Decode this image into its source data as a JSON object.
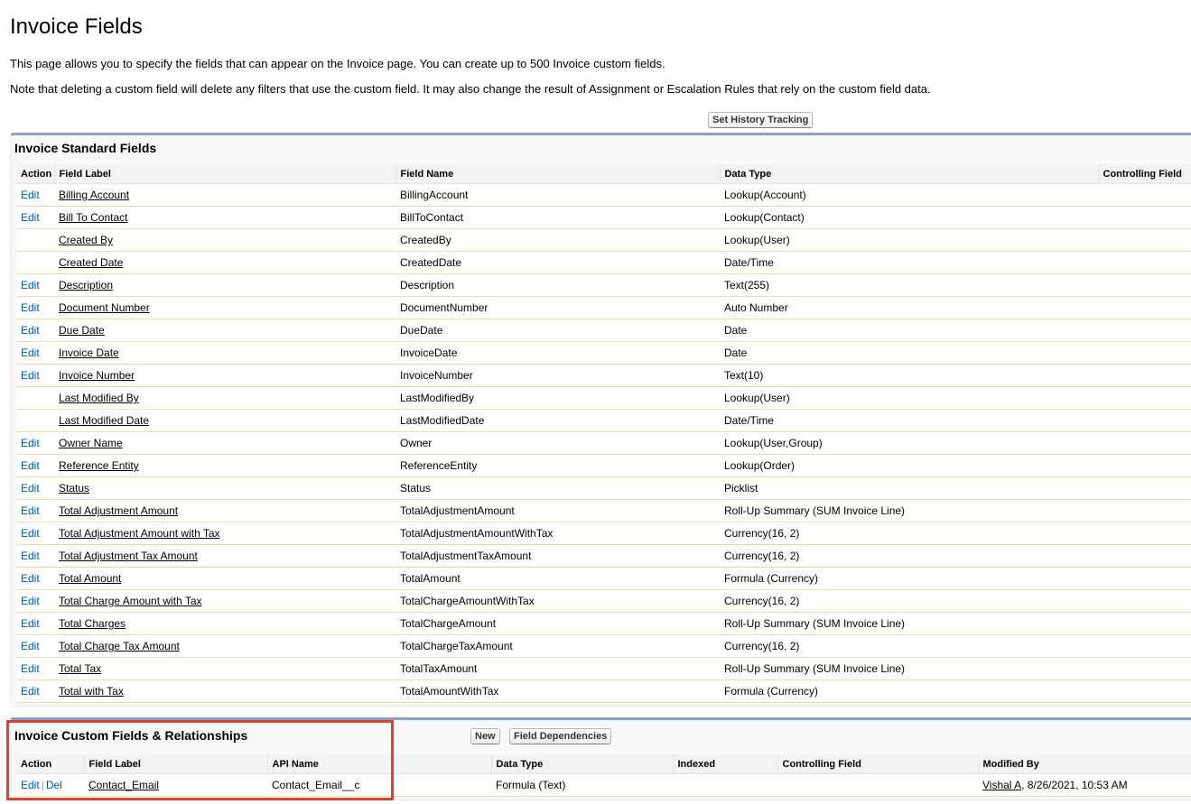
{
  "page": {
    "title": "Invoice Fields",
    "description": "This page allows you to specify the fields that can appear on the Invoice page. You can create up to 500 Invoice custom fields.",
    "note": "Note that deleting a custom field will delete any filters that use the custom field. It may also change the result of Assignment or Escalation Rules that rely on the custom field data."
  },
  "buttons": {
    "history_tracking": "Set History Tracking",
    "new": "New",
    "field_dependencies": "Field Dependencies"
  },
  "standard": {
    "title": "Invoice Standard Fields",
    "columns": [
      "Action",
      "Field Label",
      "Field Name",
      "Data Type",
      "Controlling Field"
    ],
    "rows": [
      {
        "action": "Edit",
        "label": "Billing Account",
        "name": "BillingAccount",
        "type": "Lookup(Account)"
      },
      {
        "action": "Edit",
        "label": "Bill To Contact",
        "name": "BillToContact",
        "type": "Lookup(Contact)"
      },
      {
        "action": "",
        "label": "Created By",
        "name": "CreatedBy",
        "type": "Lookup(User)"
      },
      {
        "action": "",
        "label": "Created Date",
        "name": "CreatedDate",
        "type": "Date/Time"
      },
      {
        "action": "Edit",
        "label": "Description",
        "name": "Description",
        "type": "Text(255)"
      },
      {
        "action": "Edit",
        "label": "Document Number",
        "name": "DocumentNumber",
        "type": "Auto Number"
      },
      {
        "action": "Edit",
        "label": "Due Date",
        "name": "DueDate",
        "type": "Date"
      },
      {
        "action": "Edit",
        "label": "Invoice Date",
        "name": "InvoiceDate",
        "type": "Date"
      },
      {
        "action": "Edit",
        "label": "Invoice Number",
        "name": "InvoiceNumber",
        "type": "Text(10)"
      },
      {
        "action": "",
        "label": "Last Modified By",
        "name": "LastModifiedBy",
        "type": "Lookup(User)"
      },
      {
        "action": "",
        "label": "Last Modified Date",
        "name": "LastModifiedDate",
        "type": "Date/Time"
      },
      {
        "action": "Edit",
        "label": "Owner Name",
        "name": "Owner",
        "type": "Lookup(User,Group)"
      },
      {
        "action": "Edit",
        "label": "Reference Entity",
        "name": "ReferenceEntity",
        "type": "Lookup(Order)"
      },
      {
        "action": "Edit",
        "label": "Status",
        "name": "Status",
        "type": "Picklist"
      },
      {
        "action": "Edit",
        "label": "Total Adjustment Amount",
        "name": "TotalAdjustmentAmount",
        "type": "Roll-Up Summary (SUM Invoice Line)"
      },
      {
        "action": "Edit",
        "label": "Total Adjustment Amount with Tax",
        "name": "TotalAdjustmentAmountWithTax",
        "type": "Currency(16, 2)"
      },
      {
        "action": "Edit",
        "label": "Total Adjustment Tax Amount",
        "name": "TotalAdjustmentTaxAmount",
        "type": "Currency(16, 2)"
      },
      {
        "action": "Edit",
        "label": "Total Amount",
        "name": "TotalAmount",
        "type": "Formula (Currency)"
      },
      {
        "action": "Edit",
        "label": "Total Charge Amount with Tax",
        "name": "TotalChargeAmountWithTax",
        "type": "Currency(16, 2)"
      },
      {
        "action": "Edit",
        "label": "Total Charges",
        "name": "TotalChargeAmount",
        "type": "Roll-Up Summary (SUM Invoice Line)"
      },
      {
        "action": "Edit",
        "label": "Total Charge Tax Amount",
        "name": "TotalChargeTaxAmount",
        "type": "Currency(16, 2)"
      },
      {
        "action": "Edit",
        "label": "Total Tax",
        "name": "TotalTaxAmount",
        "type": "Roll-Up Summary (SUM Invoice Line)"
      },
      {
        "action": "Edit",
        "label": "Total with Tax",
        "name": "TotalAmountWithTax",
        "type": "Formula (Currency)"
      }
    ]
  },
  "custom": {
    "title": "Invoice Custom Fields & Relationships",
    "columns": [
      "Action",
      "Field Label",
      "API Name",
      "Data Type",
      "Indexed",
      "Controlling Field",
      "Modified By"
    ],
    "rows": [
      {
        "edit": "Edit",
        "del": "Del",
        "separator": "|",
        "label": "Contact_Email",
        "api": "Contact_Email__c",
        "type": "Formula (Text)",
        "modified_user": "Vishal A",
        "modified_date": ", 8/26/2021, 10:53 AM"
      }
    ]
  },
  "colors": {
    "link_blue": "#015ba7",
    "section_border": "#8a9ebe",
    "highlight_red": "#e0402f"
  }
}
